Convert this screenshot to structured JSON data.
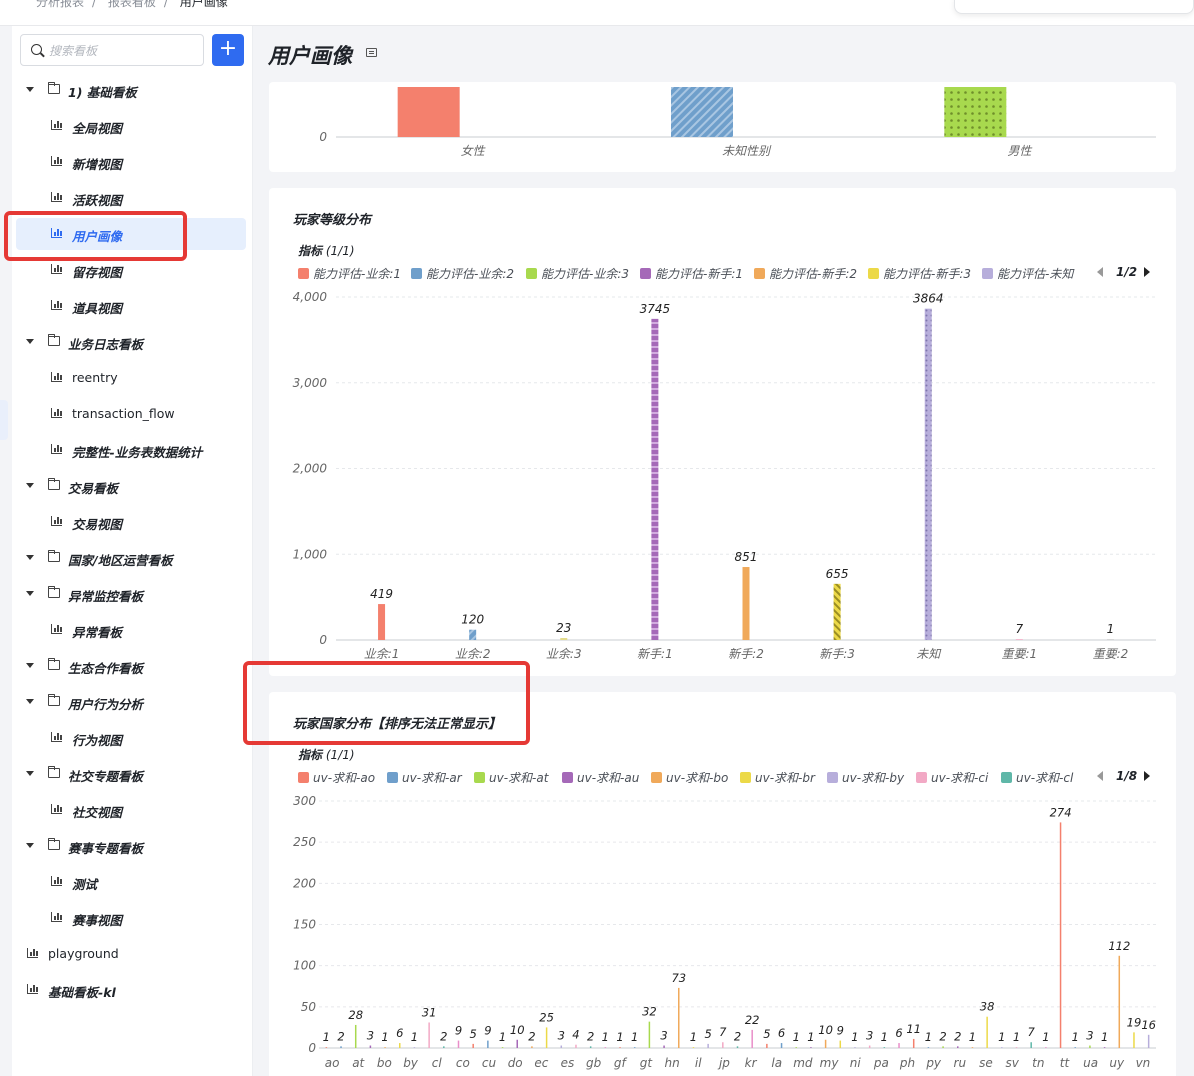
{
  "breadcrumb": [
    "分析报表",
    "报表看板",
    "用户画像"
  ],
  "sidebar": {
    "search_placeholder": "搜索看板",
    "add_label": "+",
    "items": [
      {
        "label": "1) 基础看板",
        "level": 0,
        "type": "folder"
      },
      {
        "label": "全局视图",
        "level": 1,
        "type": "chart"
      },
      {
        "label": "新增视图",
        "level": 1,
        "type": "chart"
      },
      {
        "label": "活跃视图",
        "level": 1,
        "type": "chart"
      },
      {
        "label": "用户画像",
        "level": 1,
        "type": "chart",
        "selected": true
      },
      {
        "label": "留存视图",
        "level": 1,
        "type": "chart"
      },
      {
        "label": "道具视图",
        "level": 1,
        "type": "chart"
      },
      {
        "label": "业务日志看板",
        "level": 0,
        "type": "folder"
      },
      {
        "label": "reentry",
        "level": 1,
        "type": "chart",
        "plain": true
      },
      {
        "label": "transaction_flow",
        "level": 1,
        "type": "chart",
        "plain": true
      },
      {
        "label": "完整性-业务表数据统计",
        "level": 1,
        "type": "chart"
      },
      {
        "label": "交易看板",
        "level": 0,
        "type": "folder"
      },
      {
        "label": "交易视图",
        "level": 1,
        "type": "chart"
      },
      {
        "label": "国家/地区运营看板",
        "level": 0,
        "type": "folder"
      },
      {
        "label": "异常监控看板",
        "level": 0,
        "type": "folder"
      },
      {
        "label": "异常看板",
        "level": 1,
        "type": "chart"
      },
      {
        "label": "生态合作看板",
        "level": 0,
        "type": "folder"
      },
      {
        "label": "用户行为分析",
        "level": 0,
        "type": "folder"
      },
      {
        "label": "行为视图",
        "level": 1,
        "type": "chart"
      },
      {
        "label": "社交专题看板",
        "level": 0,
        "type": "folder"
      },
      {
        "label": "社交视图",
        "level": 1,
        "type": "chart"
      },
      {
        "label": "赛事专题看板",
        "level": 0,
        "type": "folder"
      },
      {
        "label": "测试",
        "level": 1,
        "type": "chart"
      },
      {
        "label": "赛事视图",
        "level": 1,
        "type": "chart"
      },
      {
        "label": "playground",
        "level": -1,
        "type": "chart",
        "plain": true
      },
      {
        "label": "基础看板-kl",
        "level": -1,
        "type": "chart"
      }
    ]
  },
  "main": {
    "title": "用户画像"
  },
  "colors": {
    "accent": "#2f6bf0",
    "highlight": "#e53935"
  },
  "chart_data": [
    {
      "type": "bar",
      "title": "",
      "categories": [
        "女性",
        "未知性别",
        "男性"
      ],
      "y_ticks": [
        "0"
      ],
      "colors": [
        "#f4806d",
        "#6f9fcb",
        "#a8d94e"
      ],
      "patterns": [
        "solid",
        "stripe",
        "dots"
      ]
    },
    {
      "type": "bar",
      "title": "玩家等级分布",
      "metric_label": "指标",
      "metric_count": "(1/1)",
      "legend": [
        "能力评估-业余:1",
        "能力评估-业余:2",
        "能力评估-业余:3",
        "能力评估-新手:1",
        "能力评估-新手:2",
        "能力评估-新手:3",
        "能力评估-未知"
      ],
      "legend_colors": [
        "#f4806d",
        "#6f9fcb",
        "#a8d94e",
        "#a569b8",
        "#f0a95a",
        "#ecd948",
        "#b7aedb"
      ],
      "legend_page": "1/2",
      "ylim": [
        0,
        4000
      ],
      "y_ticks": [
        "0",
        "1,000",
        "2,000",
        "3,000",
        "4,000"
      ],
      "categories": [
        "业余:1",
        "业余:2",
        "业余:3",
        "新手:1",
        "新手:2",
        "新手:3",
        "未知",
        "重要:1",
        "重要:2"
      ],
      "values": [
        419,
        120,
        23,
        3745,
        851,
        655,
        3864,
        7,
        1
      ],
      "colors": [
        "#f4806d",
        "#6f9fcb",
        "#d7d06a",
        "#a569b8",
        "#f0a95a",
        "#ecd948",
        "#b7aedb",
        "#f2a9c5",
        "#cccccc"
      ]
    },
    {
      "type": "bar",
      "title": "玩家国家分布【排序无法正常显示】",
      "metric_label": "指标",
      "metric_count": "(1/1)",
      "legend": [
        "uv-求和-ao",
        "uv-求和-ar",
        "uv-求和-at",
        "uv-求和-au",
        "uv-求和-bo",
        "uv-求和-br",
        "uv-求和-by",
        "uv-求和-ci",
        "uv-求和-cl"
      ],
      "legend_colors": [
        "#f4806d",
        "#6f9fcb",
        "#a8d94e",
        "#a569b8",
        "#f0a95a",
        "#ecd948",
        "#b7aedb",
        "#f2a9c5",
        "#5fb7a8"
      ],
      "legend_page": "1/8",
      "ylim": [
        0,
        300
      ],
      "y_ticks": [
        "0",
        "50",
        "100",
        "150",
        "200",
        "250",
        "300"
      ],
      "x_tick_labels": [
        "ao",
        "at",
        "bo",
        "by",
        "cl",
        "co",
        "cu",
        "do",
        "ec",
        "es",
        "gb",
        "gf",
        "gt",
        "hn",
        "il",
        "jp",
        "kr",
        "la",
        "md",
        "my",
        "ni",
        "pa",
        "ph",
        "py",
        "ru",
        "se",
        "sv",
        "tn",
        "tt",
        "ua",
        "uy",
        "vn"
      ],
      "values": [
        1,
        2,
        28,
        3,
        1,
        6,
        1,
        31,
        2,
        9,
        5,
        9,
        1,
        10,
        2,
        25,
        3,
        4,
        2,
        1,
        1,
        1,
        32,
        3,
        73,
        1,
        5,
        7,
        2,
        22,
        5,
        6,
        1,
        1,
        10,
        9,
        1,
        3,
        1,
        6,
        11,
        1,
        2,
        2,
        1,
        38,
        1,
        1,
        7,
        1,
        274,
        1,
        3,
        1,
        112,
        19,
        16
      ],
      "colors": [
        "#f4806d",
        "#6f9fcb",
        "#a8d94e",
        "#a569b8",
        "#f0a95a",
        "#ecd948",
        "#b7aedb",
        "#f2a9c5",
        "#5fb7a8",
        "#e98ec9"
      ]
    }
  ]
}
